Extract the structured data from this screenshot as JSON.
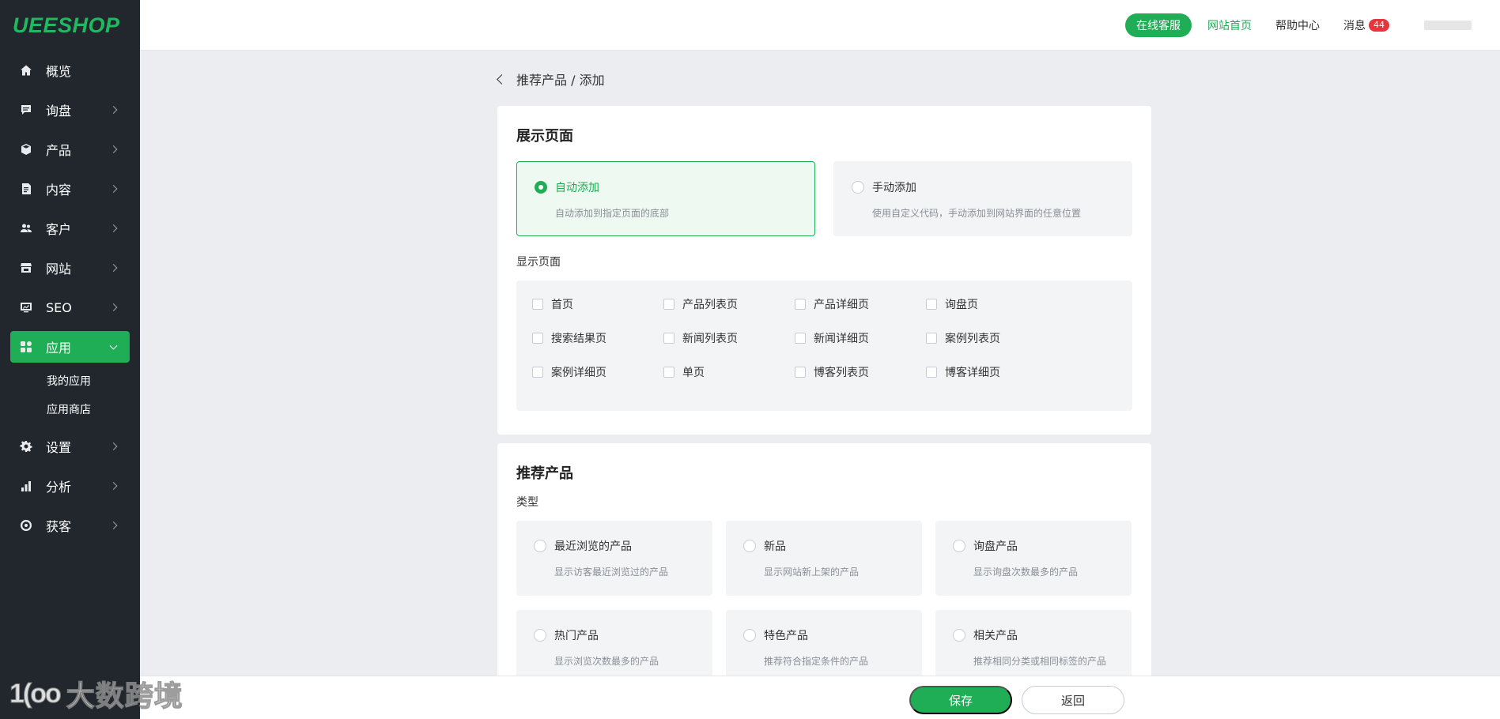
{
  "brand": {
    "logo": "UEESHOP"
  },
  "sidebar": {
    "items": [
      {
        "label": "概览",
        "icon": "home-icon"
      },
      {
        "label": "询盘",
        "icon": "chat-icon"
      },
      {
        "label": "产品",
        "icon": "box-icon"
      },
      {
        "label": "内容",
        "icon": "document-icon"
      },
      {
        "label": "客户",
        "icon": "users-icon"
      },
      {
        "label": "网站",
        "icon": "store-icon"
      },
      {
        "label": "SEO",
        "icon": "seo-icon"
      },
      {
        "label": "应用",
        "icon": "apps-icon"
      },
      {
        "label": "设置",
        "icon": "gear-icon"
      },
      {
        "label": "分析",
        "icon": "bar-chart-icon"
      },
      {
        "label": "获客",
        "icon": "target-icon"
      }
    ],
    "sub_items": [
      "我的应用",
      "应用商店"
    ]
  },
  "header": {
    "service_button": "在线客服",
    "home_link": "网站首页",
    "help_link": "帮助中心",
    "messages_label": "消息",
    "messages_count": "44"
  },
  "breadcrumb": {
    "text": "推荐产品 / 添加"
  },
  "display_section": {
    "title": "展示页面",
    "modes": [
      {
        "title": "自动添加",
        "desc": "自动添加到指定页面的底部"
      },
      {
        "title": "手动添加",
        "desc": "使用自定义代码，手动添加到网站界面的任意位置"
      }
    ],
    "pages_label": "显示页面",
    "pages": [
      "首页",
      "产品列表页",
      "产品详细页",
      "询盘页",
      "搜索结果页",
      "新闻列表页",
      "新闻详细页",
      "案例列表页",
      "案例详细页",
      "单页",
      "博客列表页",
      "博客详细页"
    ]
  },
  "recommend_section": {
    "title": "推荐产品",
    "type_label": "类型",
    "types": [
      {
        "title": "最近浏览的产品",
        "desc": "显示访客最近浏览过的产品"
      },
      {
        "title": "新品",
        "desc": "显示网站新上架的产品"
      },
      {
        "title": "询盘产品",
        "desc": "显示询盘次数最多的产品"
      },
      {
        "title": "热门产品",
        "desc": "显示浏览次数最多的产品"
      },
      {
        "title": "特色产品",
        "desc": "推荐符合指定条件的产品"
      },
      {
        "title": "相关产品",
        "desc": "推荐相同分类或相同标签的产品"
      }
    ]
  },
  "footer": {
    "save_label": "保存",
    "back_label": "返回"
  },
  "watermark": {
    "logo": "1(oo",
    "text": "大数跨境"
  },
  "colors": {
    "accent": "#1fae56",
    "sidebar": "#22272e",
    "badge": "#e8343c"
  }
}
